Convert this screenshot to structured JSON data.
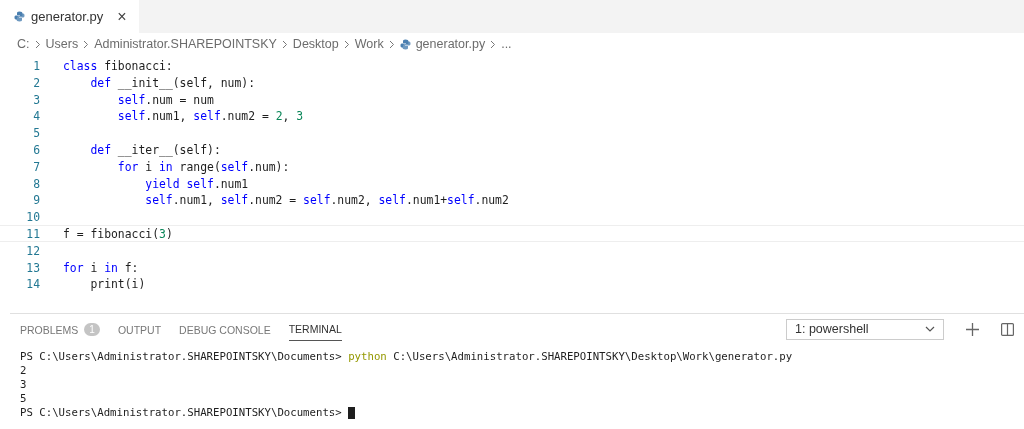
{
  "tabs": [
    {
      "label": "generator.py",
      "selected": true,
      "close": "×"
    }
  ],
  "breadcrumb": [
    "C:",
    "Users",
    "Administrator.SHAREPOINTSKY",
    "Desktop",
    "Work",
    "generator.py",
    "..."
  ],
  "code": [
    {
      "number": "1",
      "current": false,
      "tokens": [
        {
          "t": "class",
          "kind": "keyword"
        },
        {
          "t": " fibonacci:",
          "kind": "plain"
        }
      ]
    },
    {
      "number": "2",
      "current": false,
      "tokens": [
        {
          "t": "    def",
          "kind": "keyword"
        },
        {
          "t": " __init__(self, num):",
          "kind": "plain"
        }
      ]
    },
    {
      "number": "3",
      "current": false,
      "tokens": [
        {
          "t": "        self",
          "kind": "keyword"
        },
        {
          "t": ".num = num",
          "kind": "plain"
        }
      ]
    },
    {
      "number": "4",
      "current": false,
      "tokens": [
        {
          "t": "        self",
          "kind": "keyword"
        },
        {
          "t": ".num1, ",
          "kind": "plain"
        },
        {
          "t": "self",
          "kind": "keyword"
        },
        {
          "t": ".num2 = ",
          "kind": "plain"
        },
        {
          "t": "2",
          "kind": "number"
        },
        {
          "t": ", ",
          "kind": "plain"
        },
        {
          "t": "3",
          "kind": "number"
        }
      ]
    },
    {
      "number": "5",
      "current": false
    },
    {
      "number": "6",
      "current": false,
      "tokens": [
        {
          "t": "    def",
          "kind": "keyword"
        },
        {
          "t": " __iter__(self):",
          "kind": "plain"
        }
      ]
    },
    {
      "number": "7",
      "current": false,
      "tokens": [
        {
          "t": "        for",
          "kind": "keyword"
        },
        {
          "t": " i ",
          "kind": "plain"
        },
        {
          "t": "in",
          "kind": "keyword"
        },
        {
          "t": " range(",
          "kind": "plain"
        },
        {
          "t": "self",
          "kind": "keyword"
        },
        {
          "t": ".num):",
          "kind": "plain"
        }
      ]
    },
    {
      "number": "8",
      "current": false,
      "tokens": [
        {
          "t": "            yield self",
          "kind": "keyword"
        },
        {
          "t": ".num1",
          "kind": "plain"
        }
      ]
    },
    {
      "number": "9",
      "current": false,
      "tokens": [
        {
          "t": "            self",
          "kind": "keyword"
        },
        {
          "t": ".num1, ",
          "kind": "plain"
        },
        {
          "t": "self",
          "kind": "keyword"
        },
        {
          "t": ".num2 = ",
          "kind": "plain"
        },
        {
          "t": "self",
          "kind": "keyword"
        },
        {
          "t": ".num2, ",
          "kind": "plain"
        },
        {
          "t": "self",
          "kind": "keyword"
        },
        {
          "t": ".num1+",
          "kind": "plain"
        },
        {
          "t": "self",
          "kind": "keyword"
        },
        {
          "t": ".num2",
          "kind": "plain"
        }
      ]
    },
    {
      "number": "10",
      "current": false
    },
    {
      "number": "11",
      "current": true,
      "tokens": [
        {
          "t": "f = fibonacci(",
          "kind": "plain"
        },
        {
          "t": "3",
          "kind": "number"
        },
        {
          "t": ")",
          "kind": "plain"
        }
      ]
    },
    {
      "number": "12",
      "current": false
    },
    {
      "number": "13",
      "current": false,
      "tokens": [
        {
          "t": "for",
          "kind": "keyword"
        },
        {
          "t": " i ",
          "kind": "plain"
        },
        {
          "t": "in",
          "kind": "keyword"
        },
        {
          "t": " f:",
          "kind": "plain"
        }
      ]
    },
    {
      "number": "14",
      "current": false,
      "tokens": [
        {
          "t": "    print(i)",
          "kind": "plain"
        }
      ]
    }
  ],
  "panel_tabs": [
    {
      "label": "PROBLEMS",
      "selected": false,
      "badge": "1"
    },
    {
      "label": "OUTPUT",
      "selected": false
    },
    {
      "label": "DEBUG CONSOLE",
      "selected": false
    },
    {
      "label": "TERMINAL",
      "selected": true
    }
  ],
  "terminal_select": "1: powershell",
  "terminal": [
    {
      "segments": [
        {
          "t": "PS C:\\Users\\Administrator.SHAREPOINTSKY\\Documents> ",
          "kind": "plain"
        },
        {
          "t": "python",
          "kind": "command"
        },
        {
          "t": " C:\\Users\\Administrator.SHAREPOINTSKY\\Desktop\\Work\\generator.py",
          "kind": "plain"
        }
      ],
      "cursor": false
    },
    {
      "segments": [
        {
          "t": "2",
          "kind": "plain"
        }
      ],
      "cursor": false
    },
    {
      "segments": [
        {
          "t": "3",
          "kind": "plain"
        }
      ],
      "cursor": false
    },
    {
      "segments": [
        {
          "t": "5",
          "kind": "plain"
        }
      ],
      "cursor": false
    },
    {
      "segments": [
        {
          "t": "PS C:\\Users\\Administrator.SHAREPOINTSKY\\Documents> ",
          "kind": "plain"
        }
      ],
      "cursor": true
    }
  ]
}
